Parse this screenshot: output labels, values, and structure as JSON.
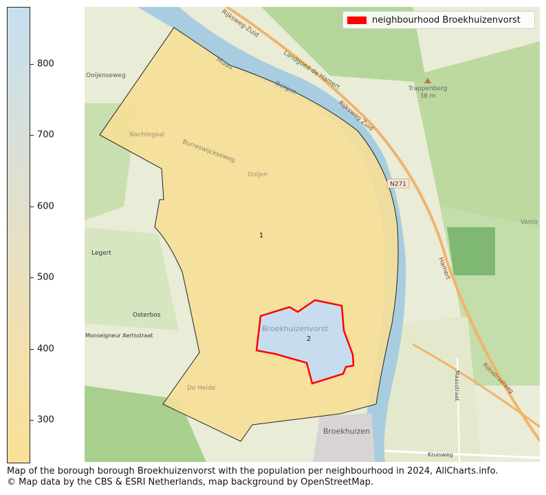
{
  "colorbar": {
    "ticks": [
      "800",
      "700",
      "600",
      "500",
      "400",
      "300"
    ],
    "min": 240,
    "max": 880,
    "colors": {
      "low": "#fae096",
      "high": "#c6dff0"
    }
  },
  "legend": {
    "label": "neighbourhood Broekhuizenvorst",
    "color": "#ff0000"
  },
  "map": {
    "neighbourhoods": [
      {
        "id": "1",
        "fill": "#f6df98"
      },
      {
        "id": "2",
        "fill": "#c7dcee"
      }
    ],
    "place_labels": {
      "ooijenseweg": "Ooijenseweg",
      "rijksweg_zuid_top": "Rijksweg-Zuid",
      "landgoed": "Landgoed de Hamert",
      "maas": "Maas",
      "bergen": "Bergen",
      "rijksweg_zuid_mid": "Rijksweg Zuid",
      "trappenberg": "Trappenberg",
      "trappenberg_height": "38 m",
      "nachtegaal": "Nachtegaal",
      "burreswijckseweg": "Burreswijckseweg",
      "ooijen": "Ooijen",
      "n271": "N271",
      "venlo": "Venlo",
      "legert": "Legert",
      "hamert": "Hamert",
      "osterbos": "Osterbos",
      "monseigneur": "Monseigneur Aertsstraat",
      "broekhuizenvorst": "Broekhuizenvorst",
      "maasstraat": "Maasstraat",
      "rijksstraatweg": "Rijksstraatweg",
      "de_heide": "De Heide",
      "broekhuizen": "Broekhuizen",
      "kruisweg": "Kruisweg"
    }
  },
  "caption": {
    "line1": "Map of the borough borough Broekhuizenvorst with the population per neighbourhood in 2024, AllCharts.info.",
    "line2": "© Map data by the CBS & ESRI Netherlands, map background by OpenStreetMap."
  }
}
